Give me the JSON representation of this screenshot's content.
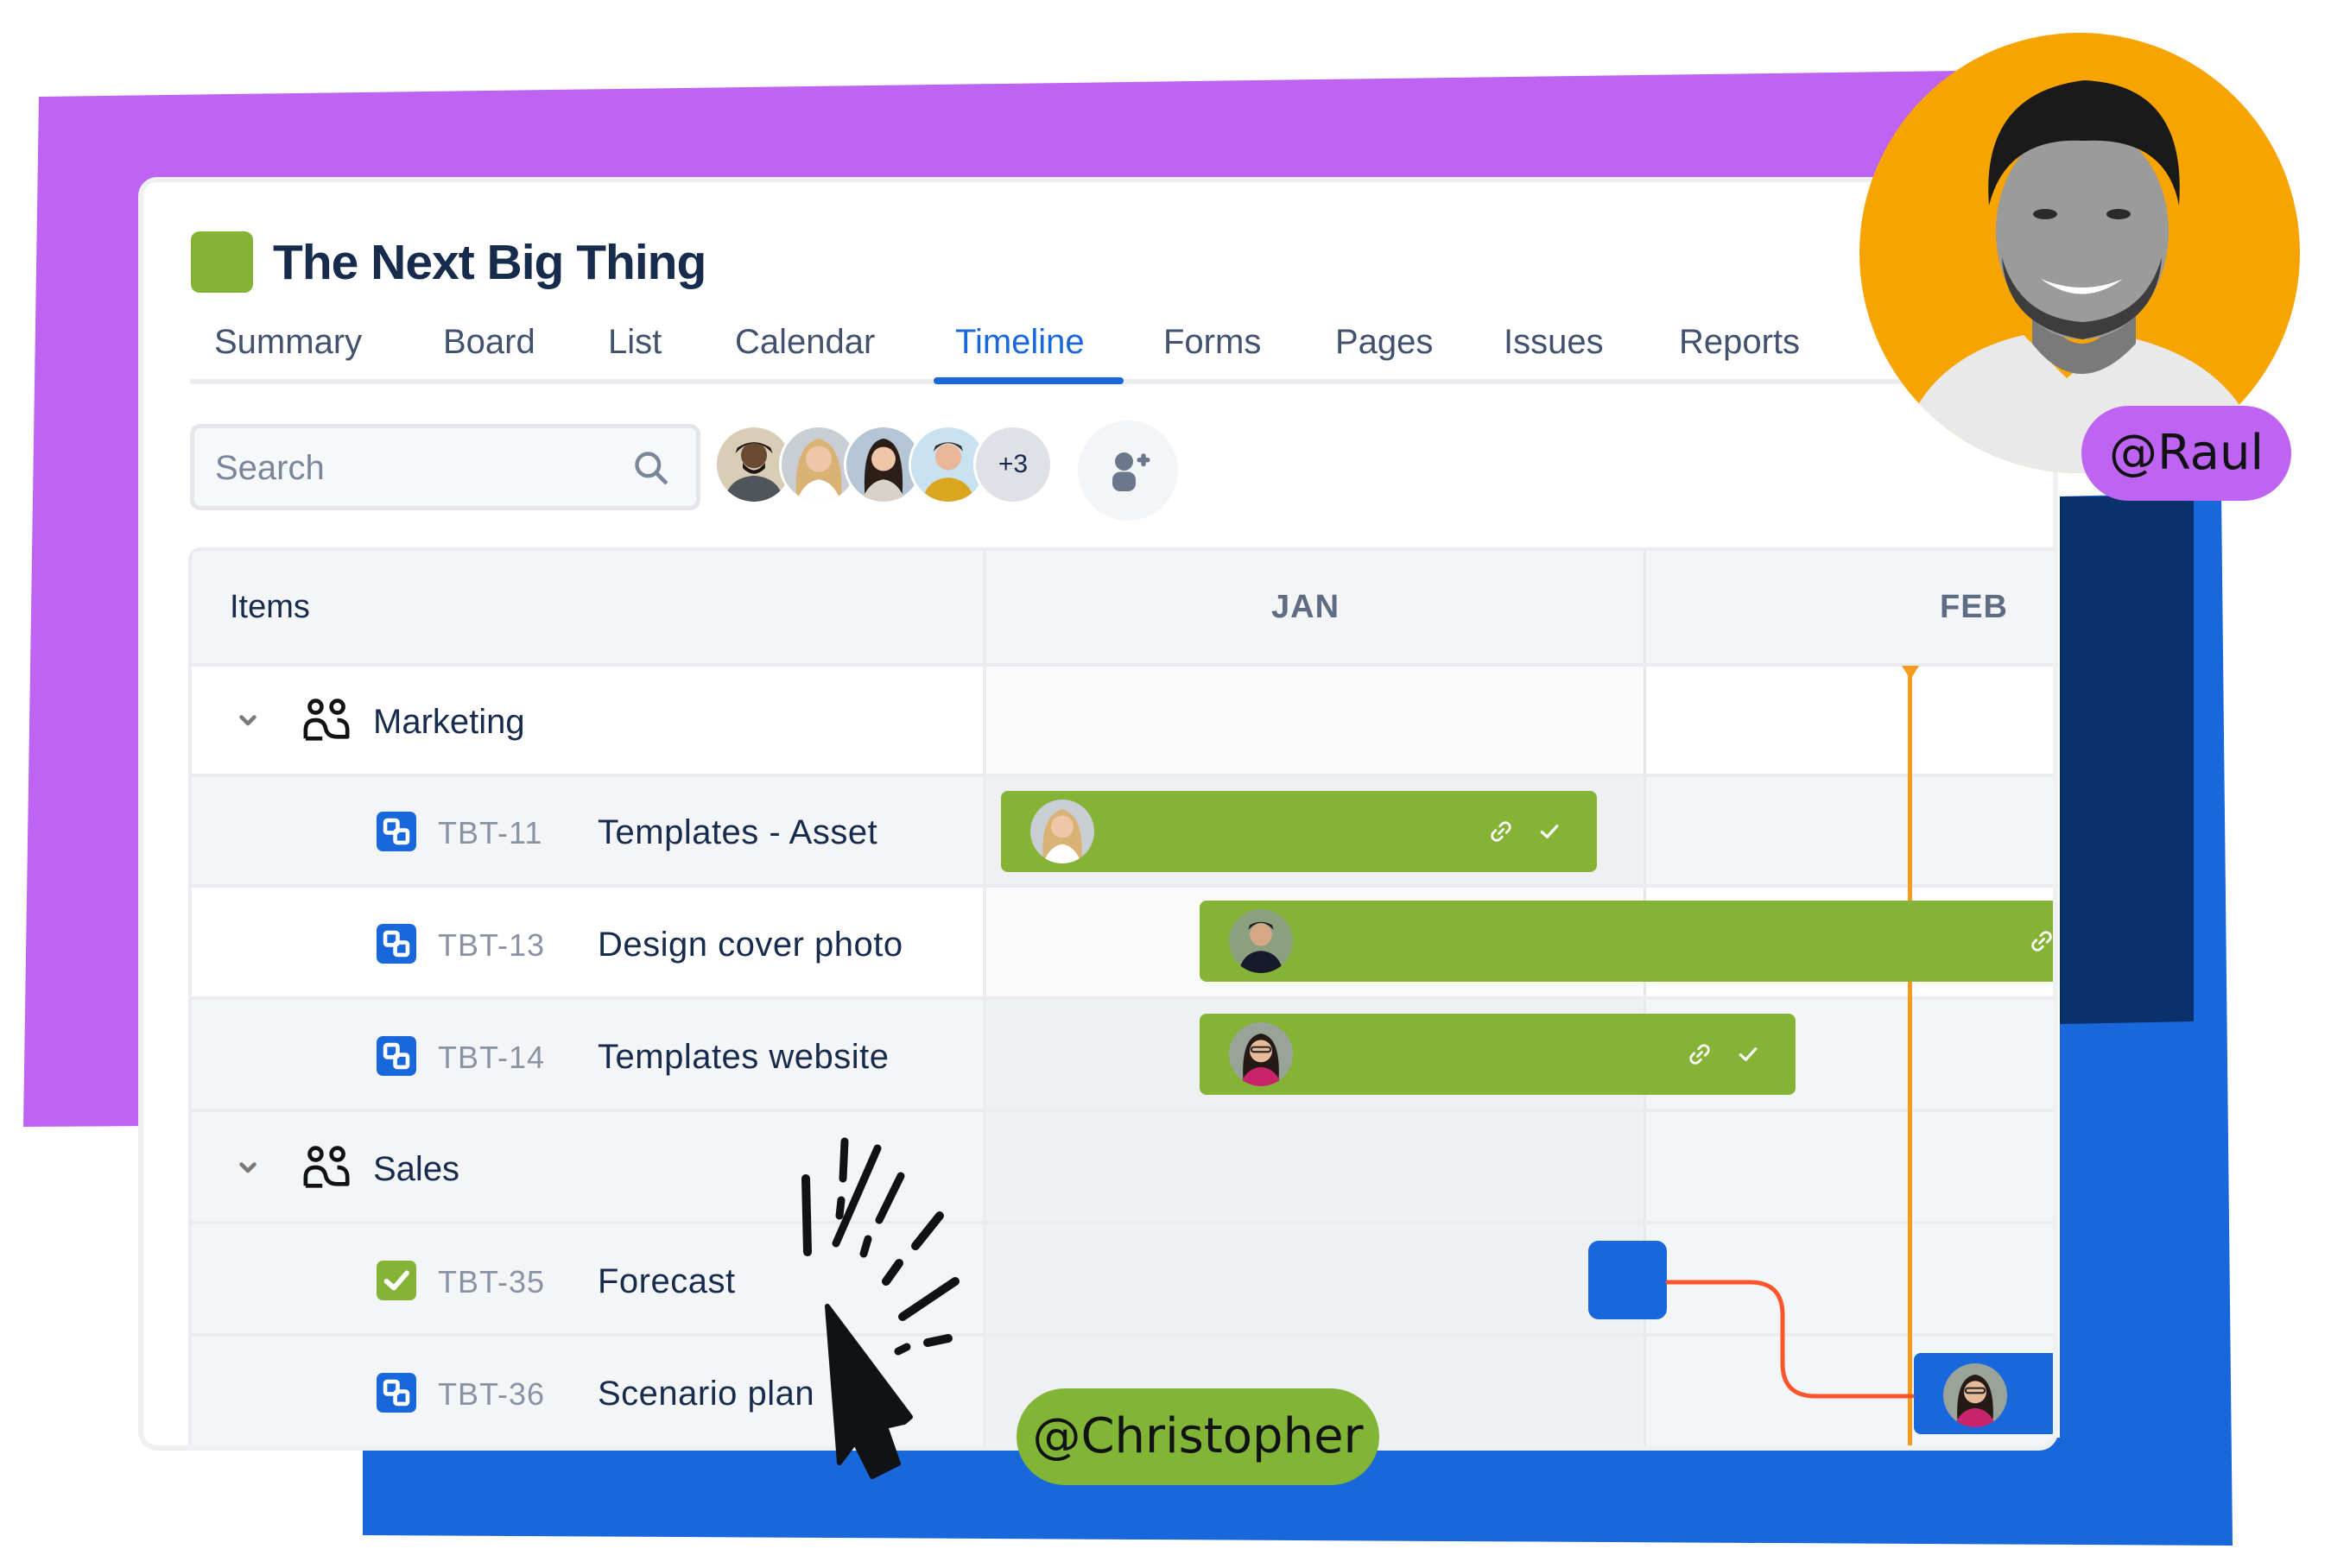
{
  "project": {
    "title": "The Next Big Thing",
    "icon_color": "#84b336"
  },
  "tabs": [
    {
      "label": "Summary",
      "active": false
    },
    {
      "label": "Board",
      "active": false
    },
    {
      "label": "List",
      "active": false
    },
    {
      "label": "Calendar",
      "active": false
    },
    {
      "label": "Timeline",
      "active": true
    },
    {
      "label": "Forms",
      "active": false
    },
    {
      "label": "Pages",
      "active": false
    },
    {
      "label": "Issues",
      "active": false
    },
    {
      "label": "Reports",
      "active": false
    }
  ],
  "toolbar": {
    "search_placeholder": "Search",
    "search_icon": "search-icon",
    "avatars": [
      "team-member-1",
      "team-member-2",
      "team-member-3",
      "team-member-4"
    ],
    "more_count": "+3",
    "add_people_icon": "add-person-icon"
  },
  "timeline": {
    "items_header": "Items",
    "months": [
      "JAN",
      "FEB"
    ],
    "groups": [
      {
        "name": "Marketing",
        "icon": "people-icon",
        "expanded": true,
        "items": [
          {
            "key": "TBT-11",
            "title": "Templates - Asset",
            "type": "subtask",
            "bar": {
              "color": "#84b336",
              "icons": [
                "link-icon",
                "check-icon"
              ]
            }
          },
          {
            "key": "TBT-13",
            "title": "Design cover photo",
            "type": "subtask",
            "bar": {
              "color": "#84b336",
              "icons": [
                "link-icon"
              ]
            }
          },
          {
            "key": "TBT-14",
            "title": "Templates website",
            "type": "subtask",
            "bar": {
              "color": "#84b336",
              "icons": [
                "link-icon",
                "check-icon"
              ]
            }
          }
        ]
      },
      {
        "name": "Sales",
        "icon": "people-icon",
        "expanded": true,
        "items": [
          {
            "key": "TBT-35",
            "title": "Forecast",
            "type": "task-done",
            "bar": {
              "color": "#1868db",
              "icons": []
            }
          },
          {
            "key": "TBT-36",
            "title": "Scenario plan",
            "type": "subtask",
            "bar": {
              "color": "#1868db",
              "icons": []
            }
          }
        ]
      }
    ],
    "today_marker_color": "#f79a1e",
    "dependency_color": "#fc552c"
  },
  "mentions": {
    "raul": "@Raul",
    "christopher": "@Christopher"
  },
  "colors": {
    "purple": "#bf63f3",
    "blue": "#1868db",
    "navy": "#09326c",
    "orange": "#f8a400",
    "green": "#84b336",
    "text_dark": "#172b4d"
  }
}
